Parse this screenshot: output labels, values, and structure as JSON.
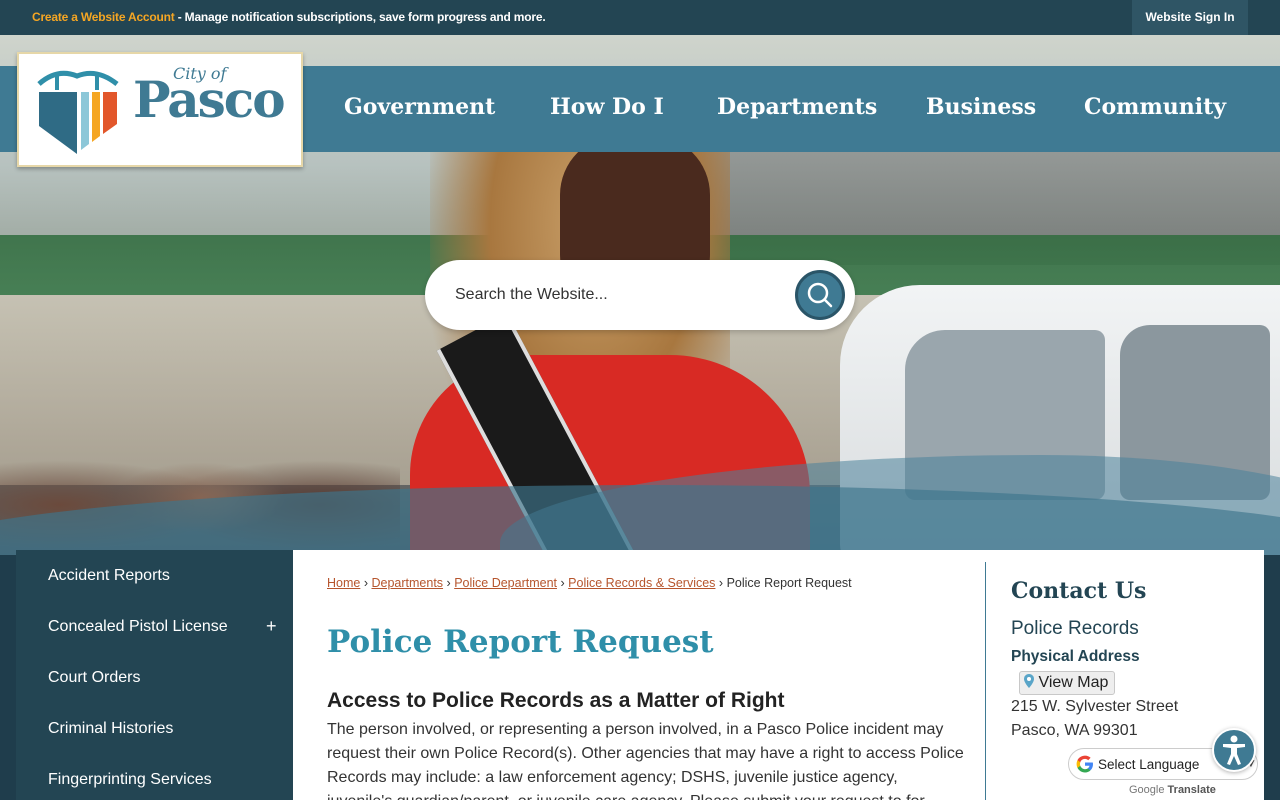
{
  "topbar": {
    "create_link": "Create a Website Account",
    "message": " - Manage notification subscriptions, save form progress and more.",
    "sign_in": "Website Sign In"
  },
  "logo": {
    "city_of": "City of",
    "name": "Pasco"
  },
  "nav": {
    "items": [
      "Government",
      "How Do I",
      "Departments",
      "Business",
      "Community"
    ]
  },
  "search": {
    "placeholder": "Search the Website..."
  },
  "sidebar": {
    "items": [
      {
        "label": "Accident Reports",
        "expandable": false
      },
      {
        "label": "Concealed Pistol License",
        "expandable": true
      },
      {
        "label": "Court Orders",
        "expandable": false
      },
      {
        "label": "Criminal Histories",
        "expandable": false
      },
      {
        "label": "Fingerprinting Services",
        "expandable": false
      }
    ],
    "expand_symbol": "+"
  },
  "breadcrumb": {
    "links": [
      "Home",
      "Departments",
      "Police Department",
      "Police Records & Services"
    ],
    "separator": "›",
    "current": "Police Report Request"
  },
  "main": {
    "title": "Police Report Request",
    "subhead": "Access to Police Records as a Matter of Right",
    "body": "The person involved, or representing a person involved, in a Pasco Police incident may request their own Police Record(s). Other agencies that may have a right to access Police Records may include: a law enforcement agency; DSHS, juvenile justice agency, juvenile's guardian/parent, or juvenile care agency. Please submit your request to for review and"
  },
  "contact": {
    "heading": "Contact Us",
    "department": "Police Records",
    "address_label": "Physical Address",
    "view_map": "View Map",
    "address_line1": "215 W. Sylvester Street",
    "address_line2": "Pasco, WA 99301"
  },
  "translate": {
    "label": "Select Language",
    "powered_prefix": "Google",
    "powered_suffix": "Translate"
  },
  "colors": {
    "topbar": "#234553",
    "nav": "#3f7a93",
    "accent_orange": "#f5a623",
    "title_teal": "#2f8fa9",
    "breadcrumb_link": "#b6552d"
  }
}
